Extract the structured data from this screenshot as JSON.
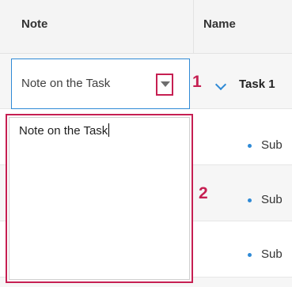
{
  "columns": {
    "note": "Note",
    "name": "Name"
  },
  "editor": {
    "value": "Note on the Task",
    "popup_value": "Note on the Task"
  },
  "callouts": {
    "one": "1",
    "two": "2"
  },
  "task": {
    "name": "Task 1"
  },
  "subtasks": [
    {
      "label": "Sub"
    },
    {
      "label": "Sub"
    },
    {
      "label": "Sub"
    }
  ],
  "colors": {
    "accent": "#2f8ad6",
    "highlight": "#c61f52"
  },
  "icons": {
    "dropdown": "triangle-down-icon",
    "expand": "chevron-down-icon",
    "bullet": "bullet-icon"
  }
}
